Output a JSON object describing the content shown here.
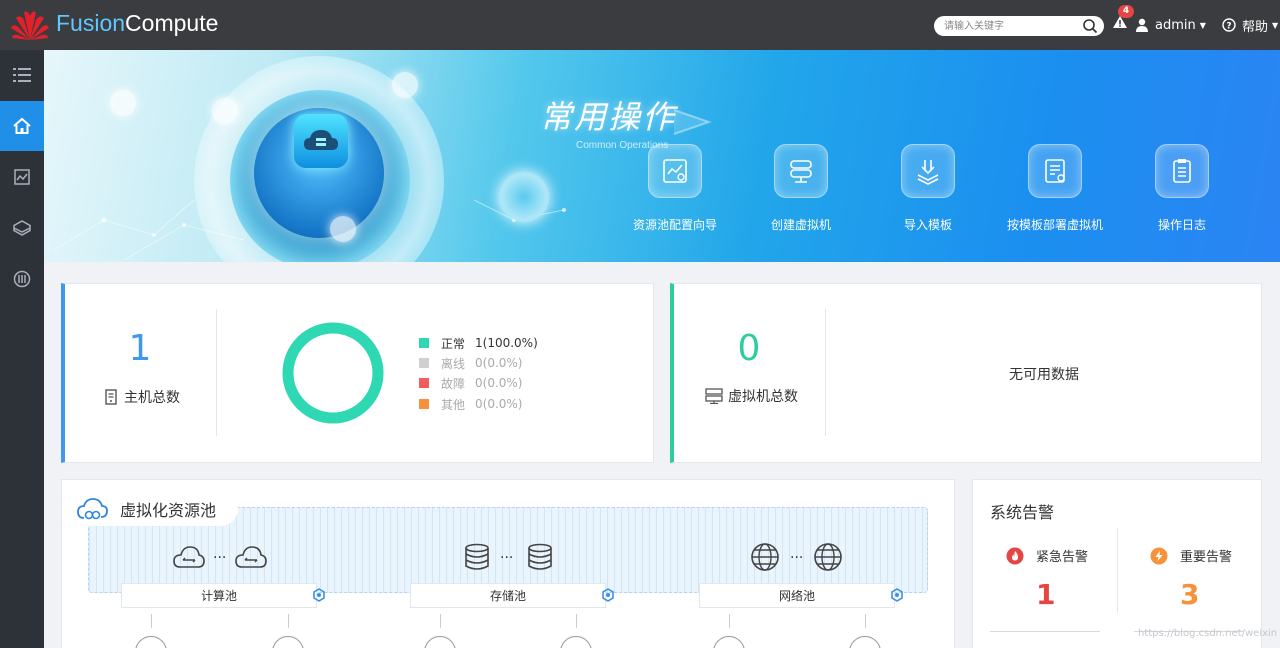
{
  "colors": {
    "topbar": "#3a3c40",
    "sidebar": "#2d3138",
    "accent_blue": "#1f8fe8",
    "status_normal": "#2ed8b3",
    "status_offline": "#d0d0d0",
    "status_fault": "#f25c5c",
    "status_other": "#f7913a",
    "alarm_urgent": "#e54545",
    "alarm_major": "#f7913a"
  },
  "header": {
    "brand_part1": "Fusion",
    "brand_part2": "Compute",
    "search_placeholder": "请输入关键字",
    "alarm_count": "4",
    "user": "admin",
    "help": "帮助"
  },
  "sidebar": {
    "items": [
      {
        "icon": "list-icon"
      },
      {
        "icon": "home-icon",
        "active": true
      },
      {
        "icon": "monitor-icon"
      },
      {
        "icon": "network-icon"
      },
      {
        "icon": "cluster-icon"
      }
    ]
  },
  "banner": {
    "title": "常用操作",
    "subtitle": "Common Operations",
    "operations": [
      {
        "label": "资源池配置向导",
        "icon": "wizard-icon"
      },
      {
        "label": "创建虚拟机",
        "icon": "create-vm-icon"
      },
      {
        "label": "导入模板",
        "icon": "import-template-icon"
      },
      {
        "label": "按模板部署虚拟机",
        "icon": "deploy-template-icon"
      },
      {
        "label": "操作日志",
        "icon": "log-icon"
      }
    ]
  },
  "hosts": {
    "total": "1",
    "label": "主机总数",
    "status_fraction_normal": 1.0,
    "legend": [
      {
        "name": "正常",
        "value": "1(100.0%)",
        "color": "#2ed8b3"
      },
      {
        "name": "离线",
        "value": "0(0.0%)",
        "color": "#d0d0d0"
      },
      {
        "name": "故障",
        "value": "0(0.0%)",
        "color": "#f25c5c"
      },
      {
        "name": "其他",
        "value": "0(0.0%)",
        "color": "#f7913a"
      }
    ]
  },
  "vms": {
    "total": "0",
    "label": "虚拟机总数",
    "nodata": "无可用数据"
  },
  "pools": {
    "title": "虚拟化资源池",
    "dots": "···",
    "items": [
      {
        "label": "计算池",
        "icon": "compute-pool-icon"
      },
      {
        "label": "存储池",
        "icon": "storage-pool-icon"
      },
      {
        "label": "网络池",
        "icon": "network-pool-icon"
      }
    ]
  },
  "alarms": {
    "title": "系统告警",
    "urgent_label": "紧急告警",
    "urgent_count": "1",
    "major_label": "重要告警",
    "major_count": "3"
  },
  "watermark": "https://blog.csdn.net/weixin"
}
